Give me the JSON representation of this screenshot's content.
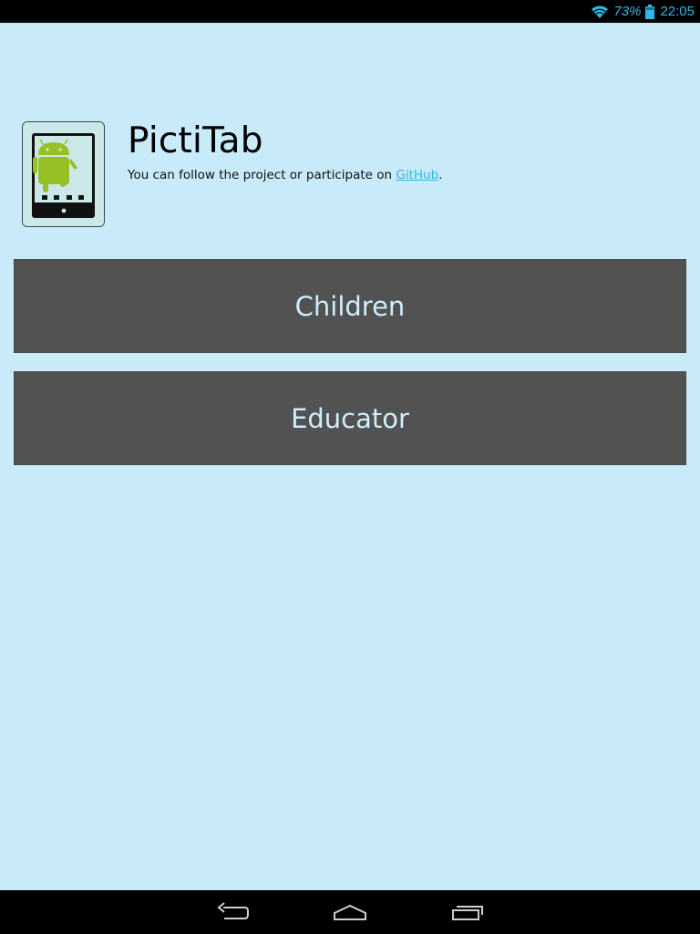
{
  "status_bar": {
    "wifi_icon": "wifi-icon",
    "battery_percent": "73%",
    "battery_icon": "battery-icon",
    "time": "22:05",
    "accent_color": "#33b5e5"
  },
  "header": {
    "app_icon": "pictitab-logo-icon",
    "title": "PictiTab",
    "subtitle_prefix": "You can follow the project or participate on ",
    "link_label": "GitHub",
    "subtitle_suffix": "."
  },
  "buttons": {
    "children_label": "Children",
    "educator_label": "Educator"
  },
  "nav_bar": {
    "back_icon": "back-icon",
    "home_icon": "home-icon",
    "recents_icon": "recent-apps-icon"
  },
  "colors": {
    "background": "#c8eaf9",
    "button_bg": "#525252",
    "button_text": "#cfeefc",
    "link": "#33b5e5"
  }
}
